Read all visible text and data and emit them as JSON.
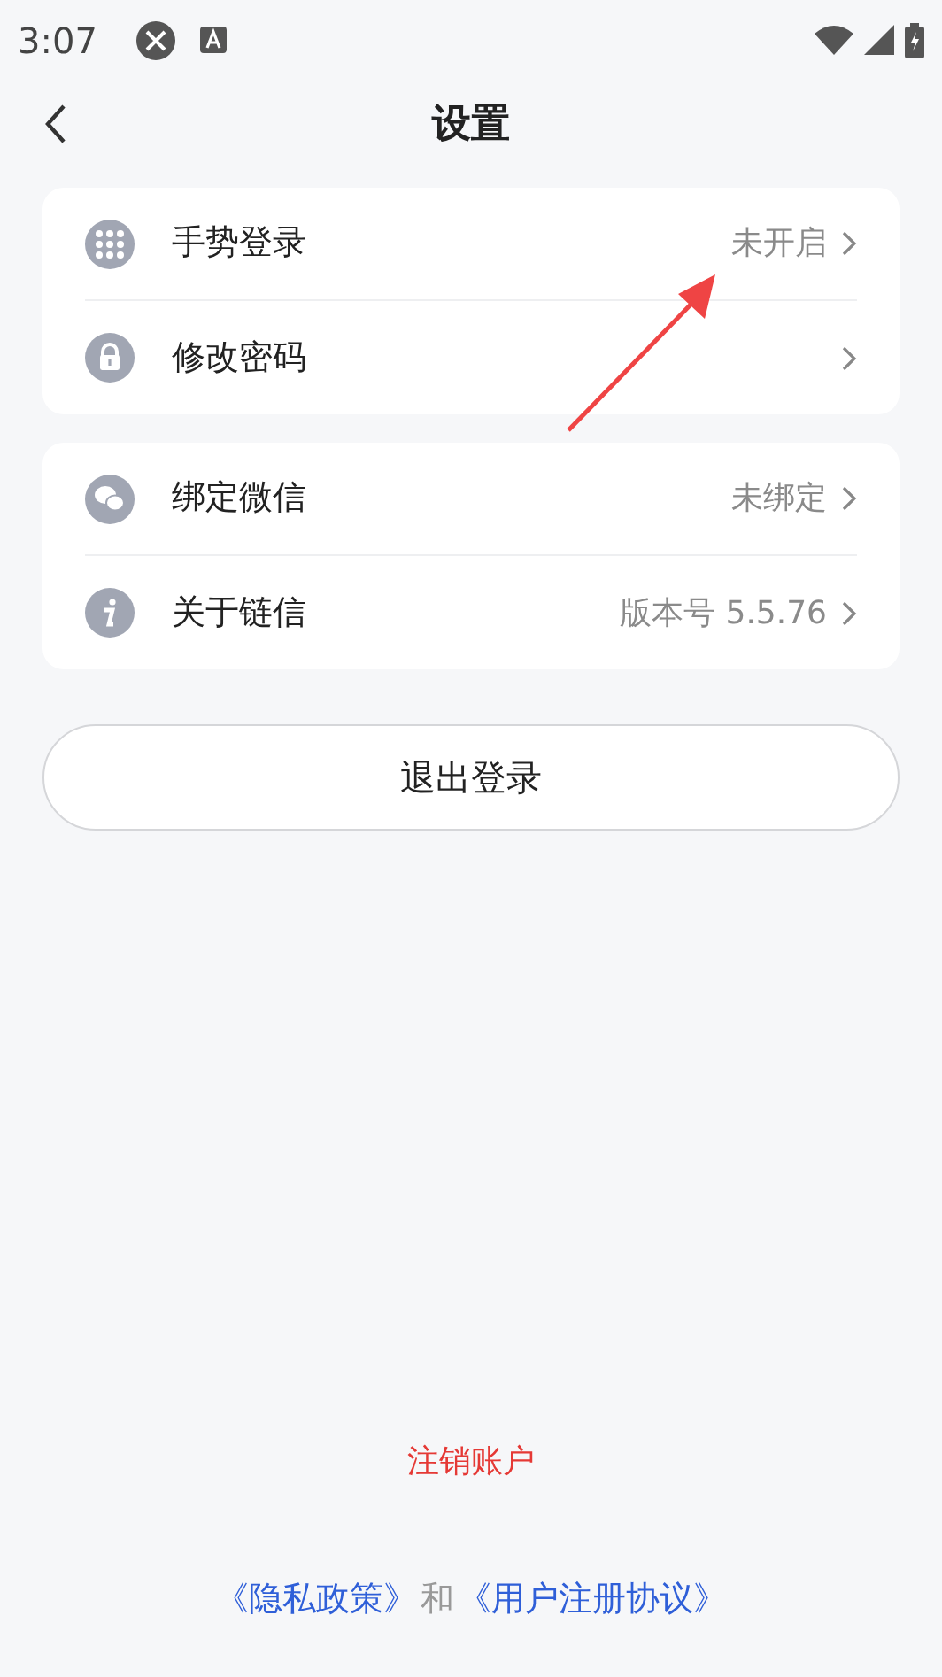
{
  "status_bar": {
    "time": "3:07"
  },
  "header": {
    "title": "设置"
  },
  "groups": [
    {
      "items": [
        {
          "kind": "gesture",
          "label": "手势登录",
          "value": "未开启"
        },
        {
          "kind": "lock",
          "label": "修改密码"
        }
      ]
    },
    {
      "items": [
        {
          "kind": "wechat",
          "label": "绑定微信",
          "value": "未绑定"
        },
        {
          "kind": "info",
          "label": "关于链信",
          "value": "版本号 5.5.76"
        }
      ]
    }
  ],
  "logout_button": "退出登录",
  "delete_account": "注销账户",
  "footer": {
    "privacy_link": "《隐私政策》",
    "joiner": "和",
    "agreement_link": "《用户注册协议》"
  }
}
